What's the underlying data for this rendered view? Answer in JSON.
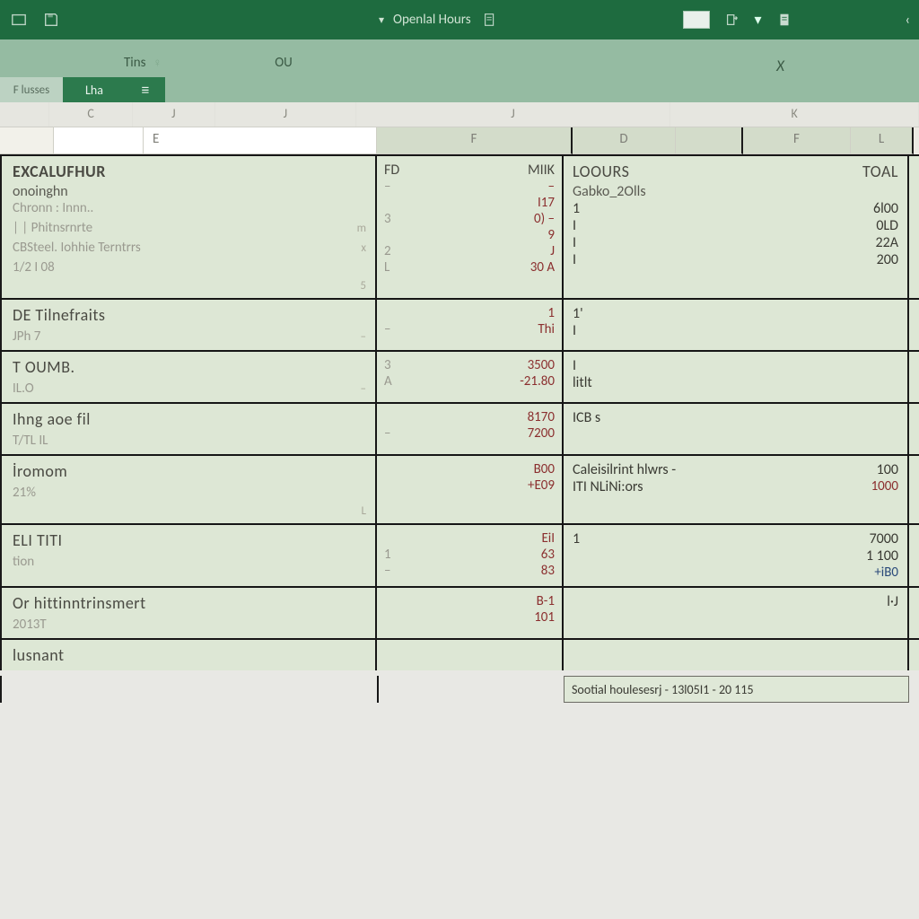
{
  "ribbon": {
    "title": "Openlal Hours",
    "tabs": [
      {
        "label": "Tins",
        "glyph": "♀"
      },
      {
        "label": "OU",
        "glyph": ""
      }
    ],
    "right_glyph": "X",
    "sheets": [
      {
        "label": "F lusses",
        "kind": "muted"
      },
      {
        "label": "Lha",
        "kind": "active"
      },
      {
        "label": "≡",
        "kind": "icon"
      }
    ]
  },
  "col_strip": [
    "C",
    "J",
    "J",
    "J",
    "K"
  ],
  "hdr_row2": [
    "",
    "",
    "E",
    "F",
    "D",
    "",
    "F",
    "L"
  ],
  "sections": [
    {
      "left": {
        "title": "EXCALUFHUR",
        "sub": "onoinghn",
        "muted": "Chronn :    Innn..",
        "rows": [
          {
            "a": "| |    Phitnsrnrte",
            "b": "m"
          },
          {
            "a": "CBSteel. Iohhie Terntrrs",
            "b": "x"
          },
          {
            "a": "1/2 I    08",
            "b": ""
          },
          {
            "a": "",
            "b": "5"
          }
        ]
      },
      "mid": {
        "ha": "FD",
        "hb": "MIIK",
        "rows": [
          [
            "–",
            "–"
          ],
          [
            "",
            "I17"
          ],
          [
            "3",
            "0) –"
          ],
          [
            "",
            "9"
          ],
          [
            "2",
            "J"
          ],
          [
            "L",
            "30 A"
          ]
        ]
      },
      "right": {
        "title": "LOOURS",
        "sub": "Gabko_2Olls",
        "total_label": "TOAL",
        "rows": [
          [
            "1",
            "6l00"
          ],
          [
            "I",
            "0LD"
          ],
          [
            "I",
            "22A"
          ],
          [
            "I",
            "200"
          ]
        ]
      }
    },
    {
      "left": {
        "title": "DE Tilnefraits",
        "rows": [
          [
            "JPh    7",
            "–"
          ]
        ]
      },
      "mid": {
        "rows": [
          [
            "",
            "1"
          ],
          [
            "–",
            "Thi"
          ]
        ]
      },
      "right": {
        "rows": [
          [
            "1'",
            ""
          ],
          [
            "I",
            ""
          ]
        ]
      }
    },
    {
      "left": {
        "title": "T OUMB.",
        "rows": [
          [
            "IL.O",
            "–"
          ]
        ]
      },
      "mid": {
        "rows": [
          [
            "3",
            "3500"
          ],
          [
            "A",
            "-21.80"
          ]
        ]
      },
      "right": {
        "rows": [
          [
            "I",
            ""
          ],
          [
            "litlt",
            ""
          ]
        ]
      }
    },
    {
      "left": {
        "title": "Ihng aoe fil",
        "rows": [
          [
            "T/TL   IL",
            ""
          ]
        ]
      },
      "mid": {
        "rows": [
          [
            "",
            "8170"
          ],
          [
            "–",
            "7200"
          ]
        ]
      },
      "right": {
        "rows": [
          [
            "",
            ""
          ],
          [
            "ICB s",
            ""
          ]
        ]
      }
    },
    {
      "left": {
        "title": "İromom",
        "rows": [
          [
            "21%",
            ""
          ],
          [
            "",
            "L"
          ]
        ]
      },
      "mid": {
        "rows": [
          [
            "",
            "B00"
          ],
          [
            "",
            "+E09"
          ]
        ]
      },
      "right": {
        "rows": [
          [
            "Caleisilrint hlwrs -",
            "100"
          ],
          [
            "ITI NLiNi:ors",
            "1000"
          ]
        ]
      }
    },
    {
      "left": {
        "title": "ELI TITI",
        "rows": [
          [
            "tion",
            ""
          ],
          [
            "",
            ""
          ]
        ]
      },
      "mid": {
        "rows": [
          [
            "",
            "EiI"
          ],
          [
            "1",
            "63"
          ],
          [
            "–",
            "83"
          ]
        ]
      },
      "right": {
        "rows": [
          [
            "1",
            "7000"
          ],
          [
            "",
            "1 100"
          ],
          [
            "",
            "+iB0"
          ]
        ]
      }
    },
    {
      "left": {
        "title": "Or hittinntrinsmert",
        "rows": [
          [
            "2013T",
            ""
          ]
        ]
      },
      "mid": {
        "rows": [
          [
            "",
            "B-1"
          ],
          [
            "",
            "101"
          ]
        ]
      },
      "right": {
        "rows": [
          [
            "",
            "l·J"
          ]
        ]
      }
    },
    {
      "left": {
        "title": "lusnant"
      },
      "mid": {
        "rows": []
      },
      "right": {
        "rows": []
      }
    }
  ],
  "status": {
    "label": "Sootial houlesesrj - 13l05I1  -  20 115"
  }
}
